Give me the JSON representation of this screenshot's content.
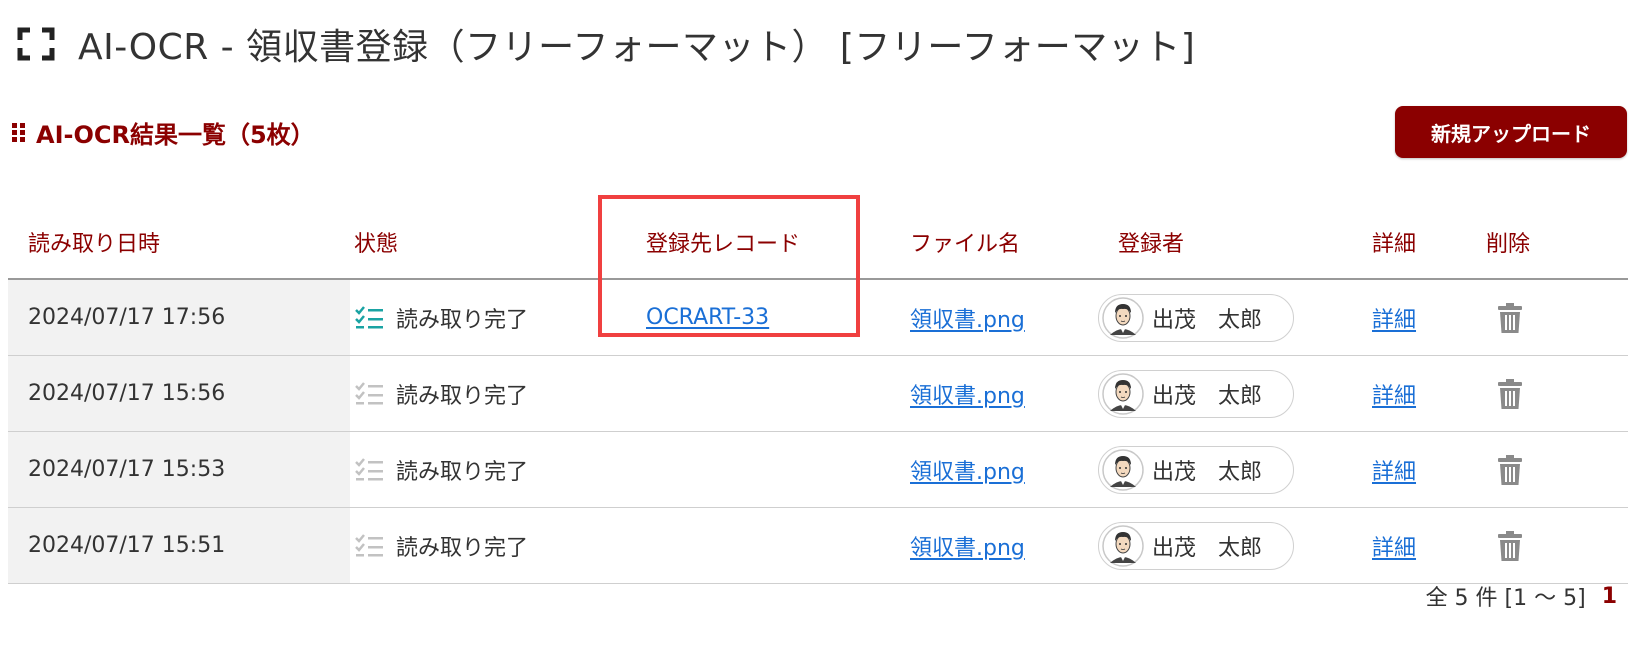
{
  "header": {
    "title": "AI-OCR - 領収書登録（フリーフォーマット） [フリーフォーマット]",
    "title_icon": "scan-bracket-icon"
  },
  "section": {
    "title": "AI-OCR結果一覧（5枚）",
    "icon": "grip-icon",
    "upload_button": "新規アップロード"
  },
  "table": {
    "columns": {
      "read_datetime": "読み取り日時",
      "status": "状態",
      "record": "登録先レコード",
      "file_name": "ファイル名",
      "registrant": "登録者",
      "detail": "詳細",
      "delete": "削除"
    },
    "rows": [
      {
        "read_datetime": "2024/07/17 17:56",
        "status": "読み取り完了",
        "status_active": true,
        "record": "OCRART-33",
        "file_name": "領収書.png",
        "registrant": "出茂　太郎",
        "detail": "詳細"
      },
      {
        "read_datetime": "2024/07/17 15:56",
        "status": "読み取り完了",
        "status_active": false,
        "record": "",
        "file_name": "領収書.png",
        "registrant": "出茂　太郎",
        "detail": "詳細"
      },
      {
        "read_datetime": "2024/07/17 15:53",
        "status": "読み取り完了",
        "status_active": false,
        "record": "",
        "file_name": "領収書.png",
        "registrant": "出茂　太郎",
        "detail": "詳細"
      },
      {
        "read_datetime": "2024/07/17 15:51",
        "status": "読み取り完了",
        "status_active": false,
        "record": "",
        "file_name": "領収書.png",
        "registrant": "出茂　太郎",
        "detail": "詳細"
      }
    ]
  },
  "pagination": {
    "summary": "全 5 件 [1 ～ 5]",
    "current_page": "1"
  },
  "colors": {
    "accent": "#8b0000",
    "link": "#1a6fd6",
    "status_active": "#1aa3a3",
    "status_inactive": "#c2c2c2",
    "highlight": "#f04040"
  }
}
